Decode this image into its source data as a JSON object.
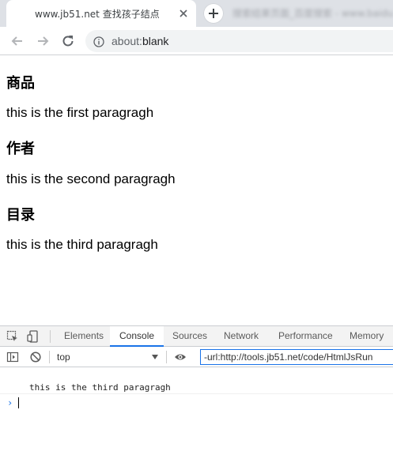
{
  "browser": {
    "tab_title": "www.jb51.net 查找孩子结点",
    "blurred_tab_text": "搜索结果页面_百度搜索 - www.baidu.com",
    "url_text": "about:blank",
    "url_scheme": "about:",
    "url_rest": "blank"
  },
  "page": {
    "sections": [
      {
        "heading": "商品",
        "paragraph": "this is the first paragragh"
      },
      {
        "heading": "作者",
        "paragraph": "this is the second paragragh"
      },
      {
        "heading": "目录",
        "paragraph": "this is the third paragragh"
      }
    ]
  },
  "devtools": {
    "tabs": [
      "Elements",
      "Console",
      "Sources",
      "Network",
      "Performance",
      "Memory"
    ],
    "active_tab": "Console",
    "context": "top",
    "filter_value": "-url:http://tools.jb51.net/code/HtmlJsRun",
    "log_output": "this is the third paragragh",
    "prompt_symbol": "›"
  },
  "colors": {
    "accent": "#1a73e8",
    "tabstrip_bg": "#dee1e6",
    "omnibox_bg": "#f1f3f4"
  },
  "icons": {
    "favicon": "none",
    "tab_close": "close-icon",
    "new_tab": "plus-icon",
    "back": "arrow-left-icon",
    "forward": "arrow-right-icon",
    "reload": "reload-icon",
    "info": "info-icon",
    "inspect": "inspect-element-icon",
    "device": "device-toolbar-icon",
    "sidebar": "console-sidebar-icon",
    "clear": "clear-console-icon",
    "eye": "eye-icon"
  }
}
